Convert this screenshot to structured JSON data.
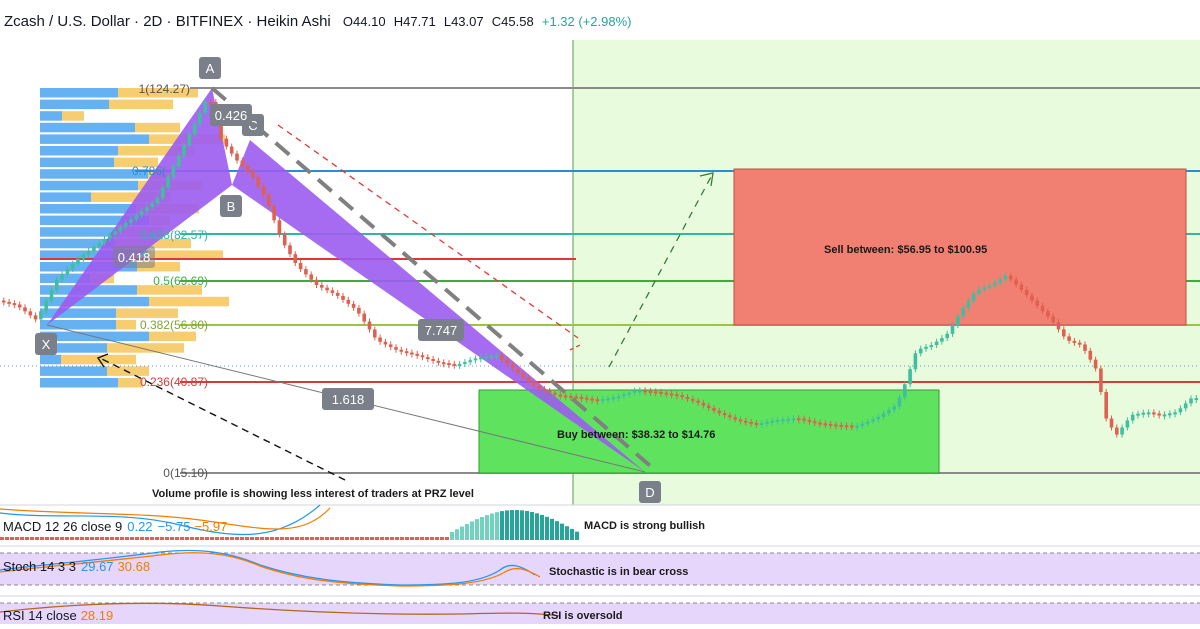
{
  "header": {
    "symbol_line": "Zcash / U.S. Dollar · 2D · BITFINEX · Heikin Ashi",
    "open": "O44.10",
    "high": "H47.71",
    "low": "L43.07",
    "close": "C45.58",
    "change": "+1.32 (+2.98%)"
  },
  "chart_data": {
    "type": "candlestick",
    "title": "Zcash / U.S. Dollar · 2D · BITFINEX · Heikin Ashi",
    "fib_levels": [
      {
        "label": "1(124.27)",
        "ratio": 1,
        "price": 124.27,
        "color": "#787b86"
      },
      {
        "label": "0.786(",
        "ratio": 0.786,
        "price": 100.95,
        "color": "#2196f3"
      },
      {
        "label": "0.618(82.57)",
        "ratio": 0.618,
        "price": 82.57,
        "color": "#26a69a"
      },
      {
        "label": "0.5(69.69)",
        "ratio": 0.5,
        "price": 69.69,
        "color": "#4caf50"
      },
      {
        "label": "0.382(56.80)",
        "ratio": 0.382,
        "price": 56.8,
        "color": "#8bc34a"
      },
      {
        "label": "0.236(40.87)",
        "ratio": 0.236,
        "price": 40.87,
        "color": "#e53935"
      },
      {
        "label": "0(15.10)",
        "ratio": 0,
        "price": 15.1,
        "color": "#787b86"
      }
    ],
    "harmonic_pattern": {
      "points": [
        "X",
        "A",
        "B",
        "C",
        "D"
      ],
      "ratios": [
        "0.426",
        "0.418",
        "7.747",
        "1.618"
      ]
    },
    "zones": [
      {
        "name": "sell",
        "text": "Sell between: $56.95 to  $100.95",
        "from": 56.95,
        "to": 100.95,
        "color": "#f28b82"
      },
      {
        "name": "buy",
        "text": "Buy between:  $38.32 to  $14.76",
        "from": 14.76,
        "to": 38.32,
        "color": "#5fe35f"
      }
    ],
    "annotations": [
      "Volume profile is showing less interest of traders at PRZ level",
      "MACD is strong bullish",
      "Stochastic is in bear cross",
      "RSI is oversold"
    ],
    "indicators": [
      {
        "name": "MACD",
        "params": "12 26 close 9",
        "values": [
          "0.22",
          "−5.75",
          "−5.97"
        ]
      },
      {
        "name": "Stoch",
        "params": "14 3 3",
        "values": [
          "29.67",
          "30.68"
        ]
      },
      {
        "name": "RSI",
        "params": "14 close",
        "values": [
          "28.19"
        ]
      }
    ]
  },
  "indicators_text": {
    "macd_name": "MACD 12 26 close 9",
    "macd_v1": "0.22",
    "macd_v2": "−5.75",
    "macd_v3": "−5.97",
    "stoch_name": "Stoch 14 3 3",
    "stoch_v1": "29.67",
    "stoch_v2": "30.68",
    "rsi_name": "RSI 14 close",
    "rsi_v1": "28.19"
  },
  "notes": {
    "volume": "Volume profile is showing less interest of traders at PRZ level",
    "macd": "MACD is strong bullish",
    "stoch": "Stochastic is in bear cross",
    "rsi": "RSI is oversold",
    "sell": "Sell between: $56.95 to  $100.95",
    "buy": "Buy between:  $38.32 to  $14.76"
  },
  "pattern_labels": {
    "x": "X",
    "a": "A",
    "b": "B",
    "c": "C",
    "d": "D",
    "r1": "0.426",
    "r2": "0.418",
    "r3": "7.747",
    "r4": "1.618"
  },
  "fib_labels": {
    "l100": "1(124.27)",
    "l786": "0.786(",
    "l618": "0.618(82.57)",
    "l500": "0.5(69.69)",
    "l382": "0.382(56.80)",
    "l236": "0.236(40.87)",
    "l000": "0(15.10)"
  }
}
